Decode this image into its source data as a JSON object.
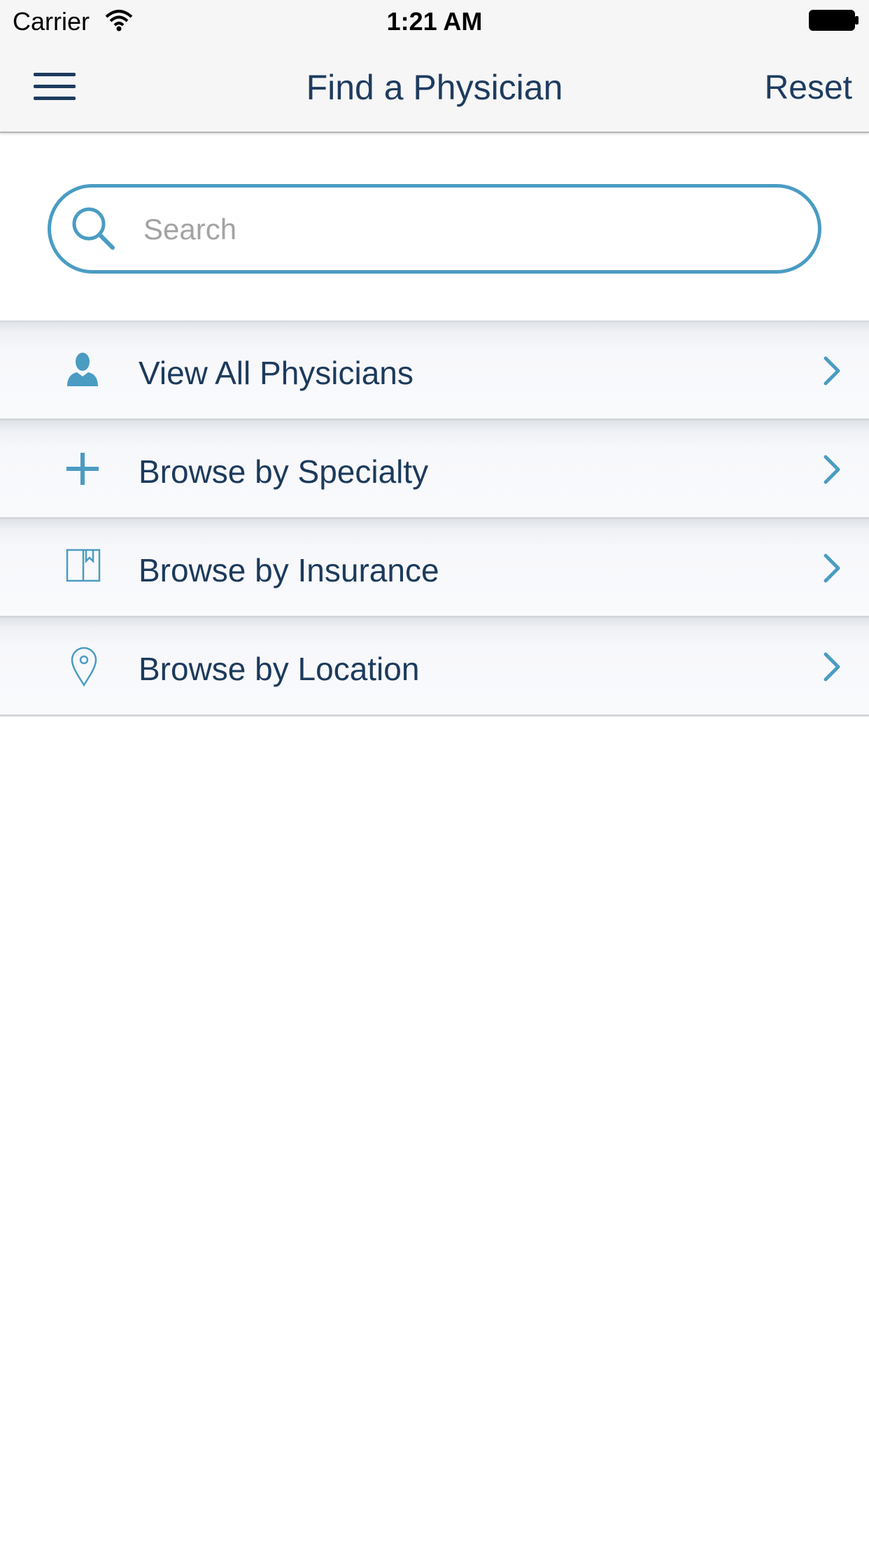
{
  "status_bar": {
    "carrier": "Carrier",
    "time": "1:21 AM",
    "wifi_icon": "wifi-icon",
    "battery_icon": "battery-icon"
  },
  "nav": {
    "title": "Find a Physician",
    "reset_label": "Reset",
    "menu_icon": "hamburger-menu-icon"
  },
  "search": {
    "placeholder": "Search",
    "value": "",
    "icon": "search-icon"
  },
  "menu": {
    "items": [
      {
        "label": "View All Physicians",
        "icon": "person-icon"
      },
      {
        "label": "Browse by Specialty",
        "icon": "plus-icon"
      },
      {
        "label": "Browse by Insurance",
        "icon": "book-icon"
      },
      {
        "label": "Browse by Location",
        "icon": "location-pin-icon"
      }
    ],
    "chevron_icon": "chevron-right-icon"
  },
  "colors": {
    "accent": "#4a9cc3",
    "text": "#1c3a5c",
    "nav_background": "#f6f6f6"
  }
}
